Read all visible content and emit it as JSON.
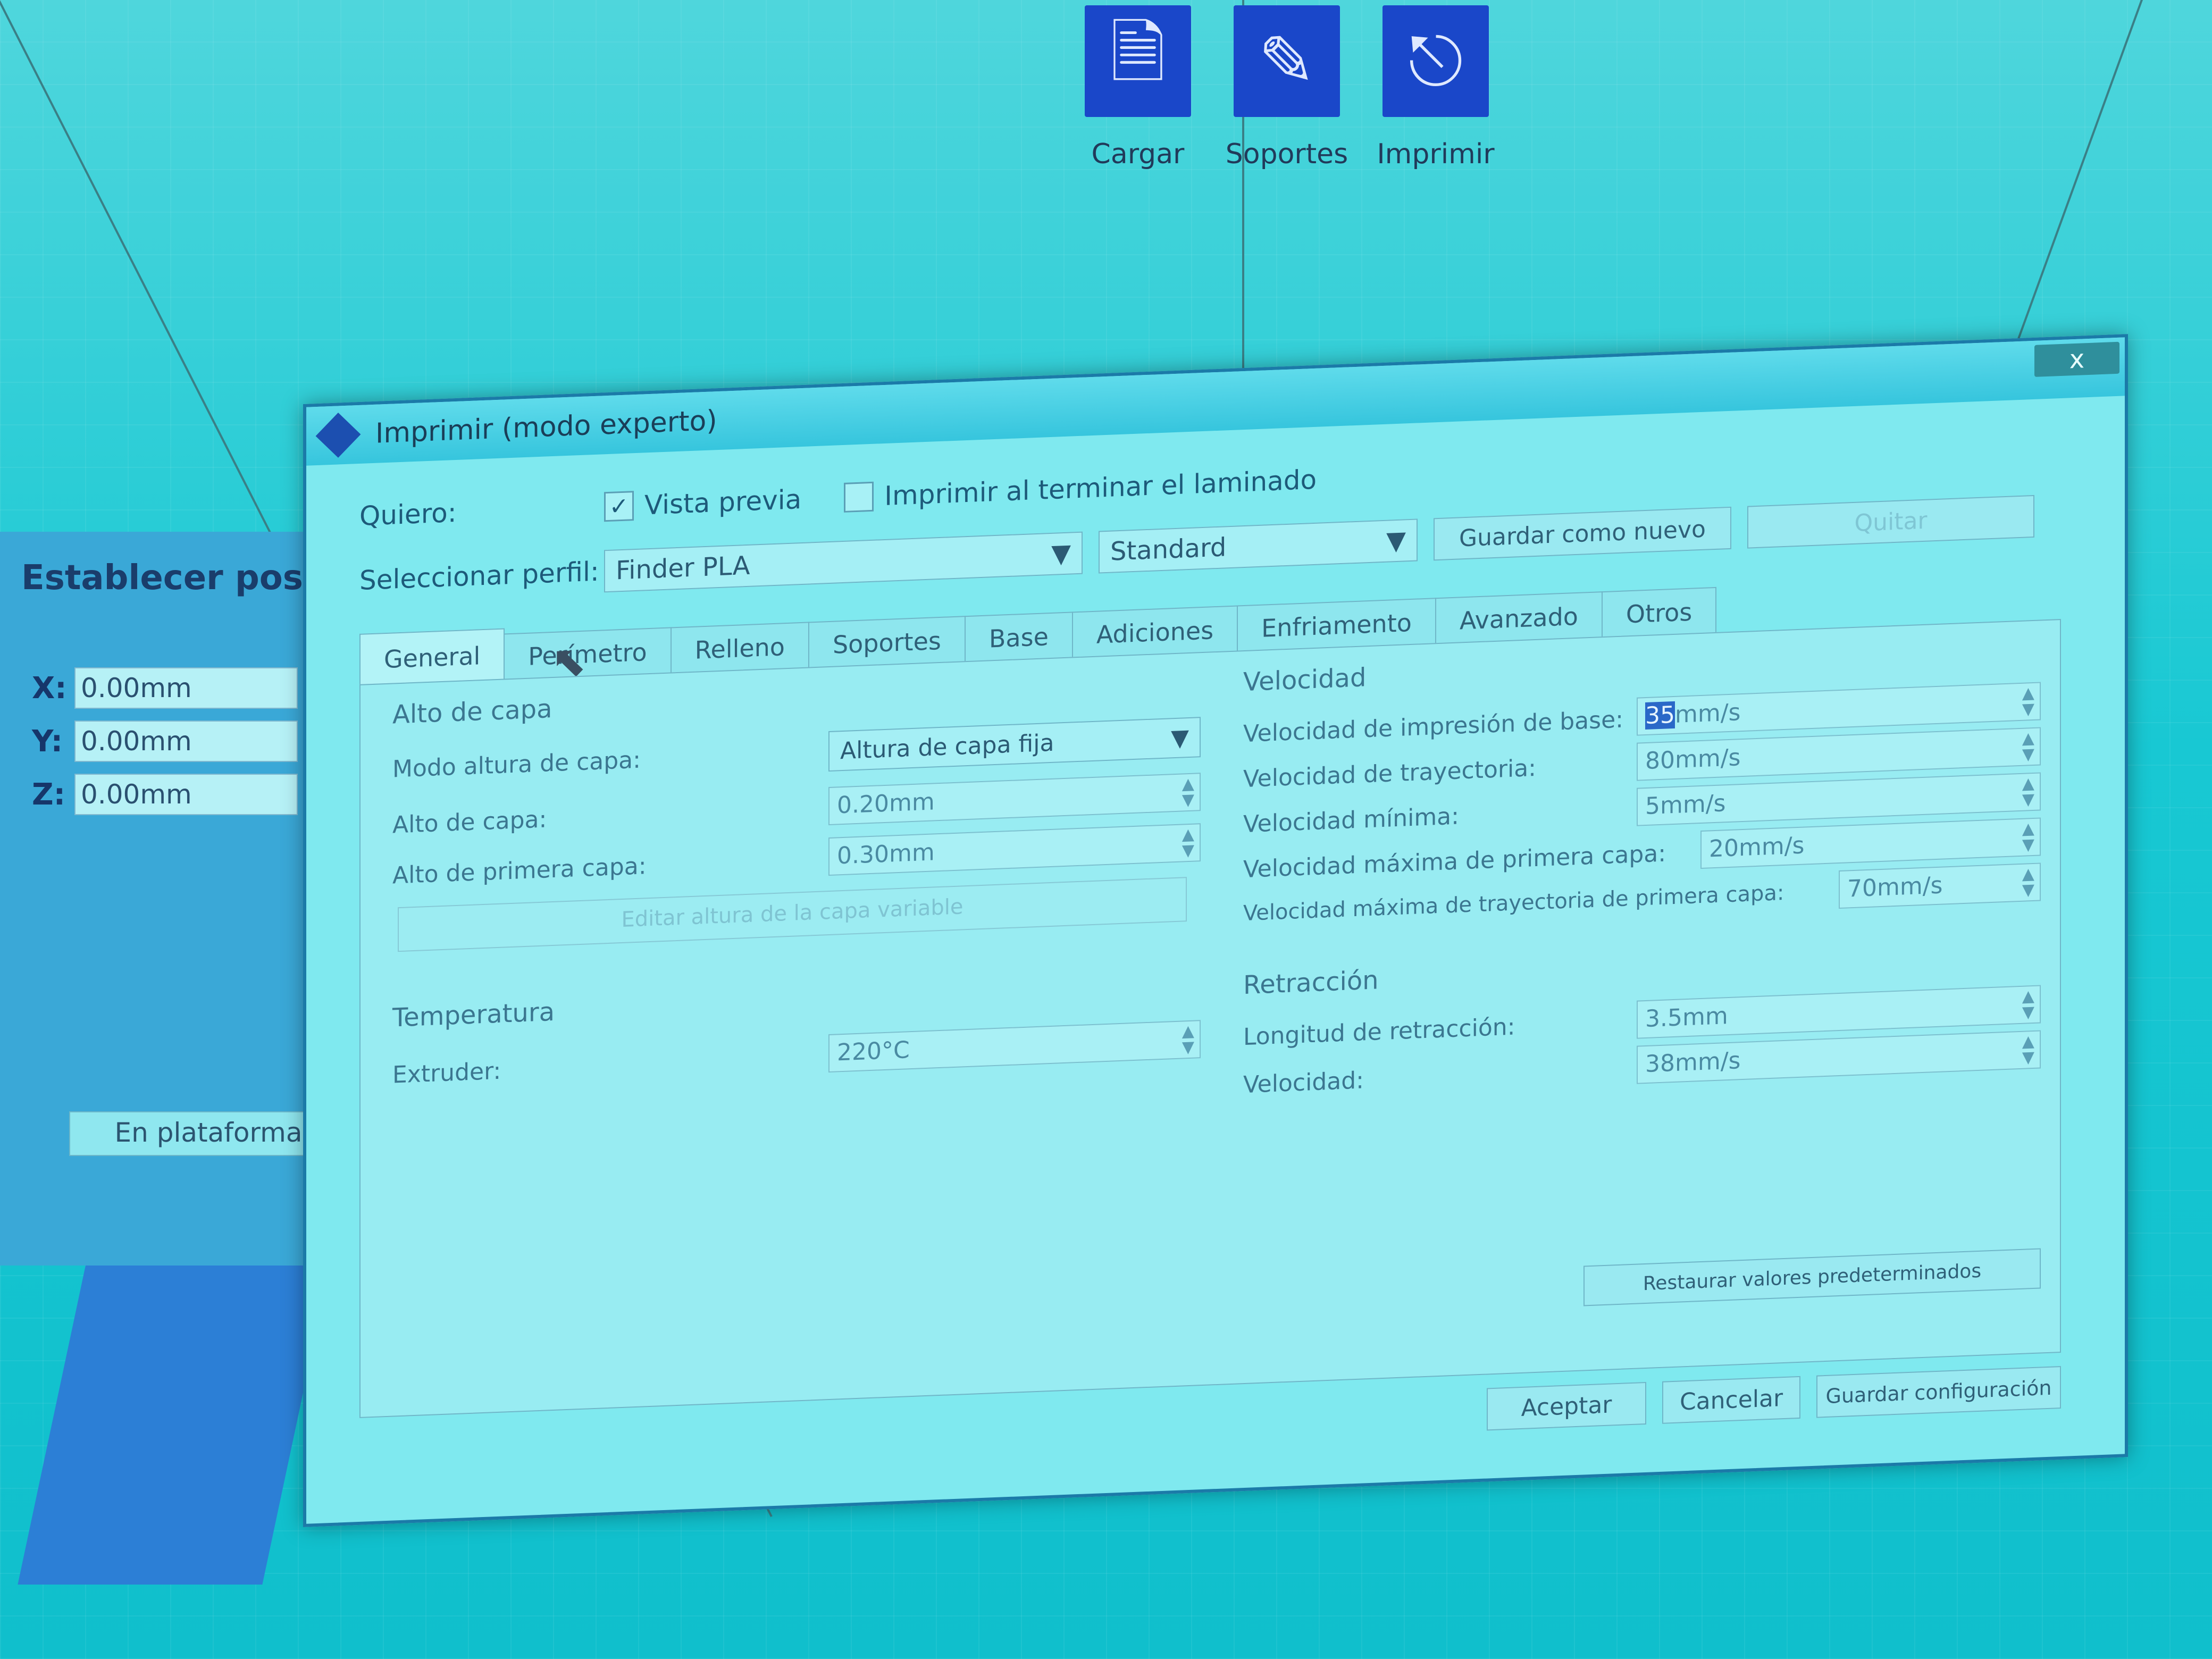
{
  "toolbar": {
    "load_label": "Cargar",
    "supports_label": "Soportes",
    "print_label": "Imprimir"
  },
  "left_panel": {
    "title": "Establecer posic",
    "x_label": "X:",
    "x_value": "0.00mm",
    "y_label": "Y:",
    "y_value": "0.00mm",
    "z_label": "Z:",
    "z_value": "0.00mm",
    "platform_button": "En plataforma"
  },
  "dialog": {
    "title": "Imprimir (modo experto)",
    "close": "x",
    "quiero_label": "Quiero:",
    "preview_label": "Vista previa",
    "preview_checked": "✓",
    "print_after_label": "Imprimir al terminar el laminado",
    "profile_label": "Seleccionar perfil:",
    "profile_value": "Finder PLA",
    "quality_value": "Standard",
    "save_new_label": "Guardar como nuevo",
    "remove_label": "Quitar",
    "tabs": [
      "General",
      "Perímetro",
      "Relleno",
      "Soportes",
      "Base",
      "Adiciones",
      "Enfriamento",
      "Avanzado",
      "Otros"
    ],
    "general": {
      "layer_section": "Alto de capa",
      "layer_mode_label": "Modo altura de capa:",
      "layer_mode_value": "Altura de capa fija",
      "layer_height_label": "Alto de capa:",
      "layer_height_value": "0.20mm",
      "first_layer_label": "Alto de primera capa:",
      "first_layer_value": "0.30mm",
      "edit_variable_label": "Editar altura de la capa variable",
      "temp_section": "Temperatura",
      "extruder_label": "Extruder:",
      "extruder_value": "220°C",
      "speed_section": "Velocidad",
      "base_speed_label": "Velocidad de impresión de base:",
      "base_speed_num": "35",
      "base_speed_unit": "mm/s",
      "travel_speed_label": "Velocidad de trayectoria:",
      "travel_speed_value": "80mm/s",
      "min_speed_label": "Velocidad mínima:",
      "min_speed_value": "5mm/s",
      "first_layer_speed_label": "Velocidad máxima de primera capa:",
      "first_layer_speed_value": "20mm/s",
      "first_layer_travel_label": "Velocidad máxima de trayectoria de primera capa:",
      "first_layer_travel_value": "70mm/s",
      "retraction_section": "Retracción",
      "retraction_length_label": "Longitud de retracción:",
      "retraction_length_value": "3.5mm",
      "retraction_speed_label": "Velocidad:",
      "retraction_speed_value": "38mm/s"
    },
    "restore_label": "Restaurar valores predeterminados",
    "accept_label": "Aceptar",
    "cancel_label": "Cancelar",
    "save_config_label": "Guardar configuración"
  }
}
